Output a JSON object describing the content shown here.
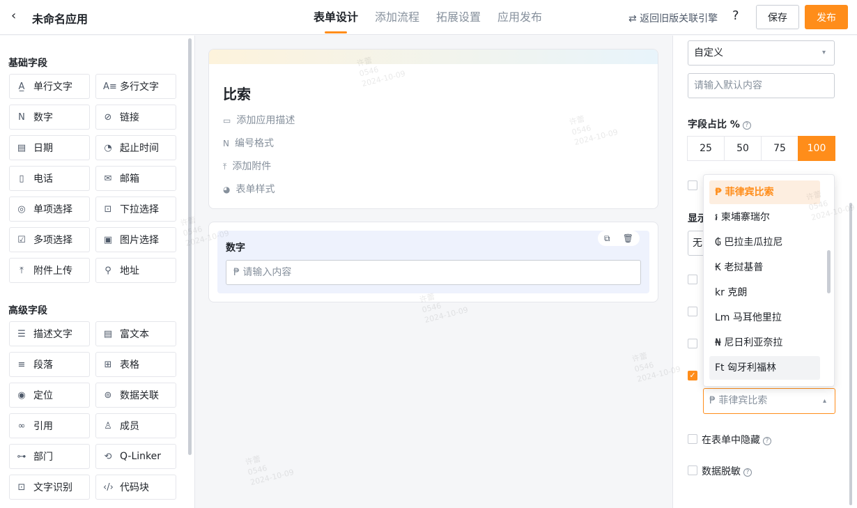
{
  "header": {
    "back_icon": "‹",
    "app_title": "未命名应用",
    "tabs": [
      {
        "label": "表单设计",
        "active": true
      },
      {
        "label": "添加流程",
        "active": false
      },
      {
        "label": "拓展设置",
        "active": false
      },
      {
        "label": "应用发布",
        "active": false
      }
    ],
    "revert_label": "⇄ 返回旧版关联引擎",
    "help_icon": "?",
    "save_label": "保存",
    "publish_label": "发布"
  },
  "left_panel": {
    "basic_title": "基础字段",
    "basic_fields": [
      {
        "label": "单行文字",
        "icon": "A̲",
        "name": "single-line-text"
      },
      {
        "label": "多行文字",
        "icon": "A≡",
        "name": "multi-line-text"
      },
      {
        "label": "数字",
        "icon": "N",
        "name": "number"
      },
      {
        "label": "链接",
        "icon": "⊘",
        "name": "link"
      },
      {
        "label": "日期",
        "icon": "▤",
        "name": "date"
      },
      {
        "label": "起止时间",
        "icon": "◔",
        "name": "time-range"
      },
      {
        "label": "电话",
        "icon": "▯",
        "name": "phone"
      },
      {
        "label": "邮箱",
        "icon": "✉",
        "name": "email"
      },
      {
        "label": "单项选择",
        "icon": "◎",
        "name": "single-choice"
      },
      {
        "label": "下拉选择",
        "icon": "⊡",
        "name": "dropdown"
      },
      {
        "label": "多项选择",
        "icon": "☑",
        "name": "multi-choice"
      },
      {
        "label": "图片选择",
        "icon": "▣",
        "name": "image-choice"
      },
      {
        "label": "附件上传",
        "icon": "⤒",
        "name": "attachment"
      },
      {
        "label": "地址",
        "icon": "⚲",
        "name": "address"
      }
    ],
    "advanced_title": "高级字段",
    "advanced_fields": [
      {
        "label": "描述文字",
        "icon": "☰",
        "name": "description"
      },
      {
        "label": "富文本",
        "icon": "▤",
        "name": "rich-text"
      },
      {
        "label": "段落",
        "icon": "≡",
        "name": "paragraph"
      },
      {
        "label": "表格",
        "icon": "⊞",
        "name": "table"
      },
      {
        "label": "定位",
        "icon": "◉",
        "name": "location"
      },
      {
        "label": "数据关联",
        "icon": "⊚",
        "name": "data-relation"
      },
      {
        "label": "引用",
        "icon": "∞",
        "name": "reference"
      },
      {
        "label": "成员",
        "icon": "♙",
        "name": "member"
      },
      {
        "label": "部门",
        "icon": "⊶",
        "name": "department"
      },
      {
        "label": "Q-Linker",
        "icon": "⟲",
        "name": "q-linker"
      },
      {
        "label": "文字识别",
        "icon": "⊡",
        "name": "ocr"
      },
      {
        "label": "代码块",
        "icon": "‹/›",
        "name": "code-block"
      }
    ]
  },
  "canvas": {
    "form_title": "比索",
    "options": [
      {
        "icon": "▭",
        "label": "添加应用描述",
        "name": "add-description"
      },
      {
        "icon": "N",
        "label": "编号格式",
        "name": "number-format"
      },
      {
        "icon": "⤒",
        "label": "添加附件",
        "name": "add-attachment"
      },
      {
        "icon": "◕",
        "label": "表单样式",
        "name": "form-style"
      }
    ],
    "field": {
      "label": "数字",
      "placeholder": "₱ 请输入内容",
      "copy_icon": "⧉",
      "delete_icon": "🗑"
    }
  },
  "right_panel": {
    "default_select": "自定义",
    "default_placeholder": "请输入默认内容",
    "ratio_label": "字段占比 %",
    "ratio_options": [
      {
        "label": "25",
        "active": false
      },
      {
        "label": "50",
        "active": false
      },
      {
        "label": "75",
        "active": false
      },
      {
        "label": "100",
        "active": true
      }
    ],
    "display_label_partial": "显示",
    "hidden_select_partial": "无",
    "currency_select_value": "₱ 菲律宾比索",
    "hide_in_form_label": "在表单中隐藏",
    "desensitize_label": "数据脱敏"
  },
  "currency_dropdown": {
    "items": [
      {
        "label": "₱ 菲律宾比索",
        "state": "selected"
      },
      {
        "label": "៛ 柬埔寨瑞尔",
        "state": ""
      },
      {
        "label": "₲ 巴拉圭瓜拉尼",
        "state": ""
      },
      {
        "label": "₭ 老挝基普",
        "state": ""
      },
      {
        "label": "kr 克朗",
        "state": ""
      },
      {
        "label": "Lm 马耳他里拉",
        "state": ""
      },
      {
        "label": "₦ 尼日利亚奈拉",
        "state": ""
      },
      {
        "label": "Ft 匈牙利福林",
        "state": "hover"
      }
    ]
  },
  "watermark": {
    "name": "许蕾",
    "code": "0546",
    "date": "2024-10-09"
  },
  "colors": {
    "accent": "#ff8d1a",
    "border": "#e5e6eb",
    "muted_text": "#86909c"
  }
}
